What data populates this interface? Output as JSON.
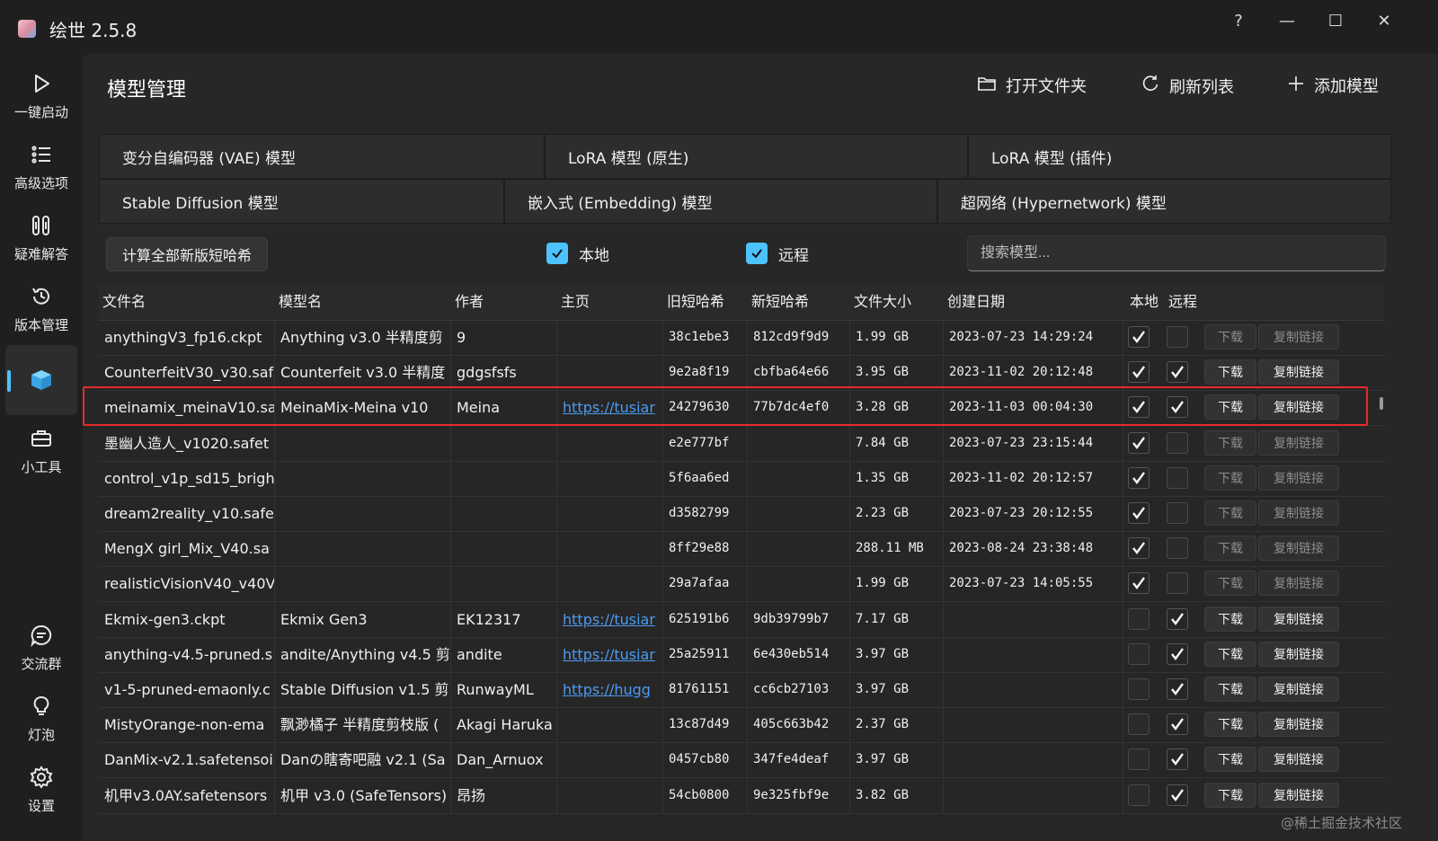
{
  "app": {
    "title": "绘世 2.5.8"
  },
  "window_controls": {
    "help": "?",
    "minimize": "—",
    "maximize": "☐",
    "close": "✕"
  },
  "nav": {
    "items": [
      {
        "label": "一键启动",
        "icon": "play-icon"
      },
      {
        "label": "高级选项",
        "icon": "list-icon"
      },
      {
        "label": "疑难解答",
        "icon": "tools-icon"
      },
      {
        "label": "版本管理",
        "icon": "history-icon"
      },
      {
        "label": "",
        "icon": "cube-icon"
      },
      {
        "label": "小工具",
        "icon": "toolbox-icon"
      },
      {
        "label": "交流群",
        "icon": "chat-icon"
      },
      {
        "label": "灯泡",
        "icon": "bulb-icon"
      },
      {
        "label": "设置",
        "icon": "gear-icon"
      }
    ]
  },
  "page": {
    "title": "模型管理"
  },
  "actions": {
    "open_folder": "打开文件夹",
    "refresh": "刷新列表",
    "add_model": "添加模型"
  },
  "tabs": {
    "row1": [
      "变分自编码器 (VAE) 模型",
      "LoRA 模型 (原生)",
      "LoRA 模型 (插件)"
    ],
    "row2": [
      "Stable Diffusion 模型",
      "嵌入式 (Embedding) 模型",
      "超网络 (Hypernetwork) 模型"
    ]
  },
  "toolbar": {
    "calc_button": "计算全部新版短哈希",
    "local_label": "本地",
    "local_checked": true,
    "remote_label": "远程",
    "remote_checked": true,
    "search_placeholder": "搜索模型..."
  },
  "table": {
    "columns": [
      "文件名",
      "模型名",
      "作者",
      "主页",
      "旧短哈希",
      "新短哈希",
      "文件大小",
      "创建日期",
      "本地",
      "远程"
    ],
    "download_label": "下载",
    "copy_label": "复制链接",
    "rows": [
      {
        "file": "anythingV3_fp16.ckpt",
        "model": "Anything v3.0 半精度剪",
        "author": "9",
        "home": "",
        "old": "38c1ebe3",
        "new": "812cd9f9d9",
        "size": "1.99 GB",
        "date": "2023-07-23 14:29:24",
        "local": true,
        "remote": false
      },
      {
        "file": "CounterfeitV30_v30.saf",
        "model": "Counterfeit v3.0 半精度",
        "author": "gdgsfsfs",
        "home": "",
        "old": "9e2a8f19",
        "new": "cbfba64e66",
        "size": "3.95 GB",
        "date": "2023-11-02 20:12:48",
        "local": true,
        "remote": true
      },
      {
        "file": "meinamix_meinaV10.sa",
        "model": "MeinaMix-Meina v10",
        "author": "Meina",
        "home": "https://tusiar",
        "old": "24279630",
        "new": "77b7dc4ef0",
        "size": "3.28 GB",
        "date": "2023-11-03 00:04:30",
        "local": true,
        "remote": true
      },
      {
        "file": "墨幽人造人_v1020.safet",
        "model": "",
        "author": "",
        "home": "",
        "old": "e2e777bf",
        "new": "",
        "size": "7.84 GB",
        "date": "2023-07-23 23:15:44",
        "local": true,
        "remote": false
      },
      {
        "file": "control_v1p_sd15_brigh",
        "model": "",
        "author": "",
        "home": "",
        "old": "5f6aa6ed",
        "new": "",
        "size": "1.35 GB",
        "date": "2023-11-02 20:12:57",
        "local": true,
        "remote": false
      },
      {
        "file": "dream2reality_v10.safe",
        "model": "",
        "author": "",
        "home": "",
        "old": "d3582799",
        "new": "",
        "size": "2.23 GB",
        "date": "2023-07-23 20:12:55",
        "local": true,
        "remote": false
      },
      {
        "file": "MengX girl_Mix_V40.sa",
        "model": "",
        "author": "",
        "home": "",
        "old": "8ff29e88",
        "new": "",
        "size": "288.11 MB",
        "date": "2023-08-24 23:38:48",
        "local": true,
        "remote": false
      },
      {
        "file": "realisticVisionV40_v40V",
        "model": "",
        "author": "",
        "home": "",
        "old": "29a7afaa",
        "new": "",
        "size": "1.99 GB",
        "date": "2023-07-23 14:05:55",
        "local": true,
        "remote": false
      },
      {
        "file": "Ekmix-gen3.ckpt",
        "model": "Ekmix Gen3",
        "author": "EK12317",
        "home": "https://tusiar",
        "old": "625191b6",
        "new": "9db39799b7",
        "size": "7.17 GB",
        "date": "",
        "local": false,
        "remote": true
      },
      {
        "file": "anything-v4.5-pruned.s",
        "model": "andite/Anything v4.5 剪",
        "author": "andite",
        "home": "https://tusiar",
        "old": "25a25911",
        "new": "6e430eb514",
        "size": "3.97 GB",
        "date": "",
        "local": false,
        "remote": true
      },
      {
        "file": "v1-5-pruned-emaonly.c",
        "model": "Stable Diffusion v1.5 剪",
        "author": "RunwayML",
        "home": "https://hugg",
        "old": "81761151",
        "new": "cc6cb27103",
        "size": "3.97 GB",
        "date": "",
        "local": false,
        "remote": true
      },
      {
        "file": "MistyOrange-non-ema",
        "model": "飘渺橘子 半精度剪枝版 (",
        "author": "Akagi Haruka",
        "home": "",
        "old": "13c87d49",
        "new": "405c663b42",
        "size": "2.37 GB",
        "date": "",
        "local": false,
        "remote": true
      },
      {
        "file": "DanMix-v2.1.safetensoi",
        "model": "Danの瞎寄吧融 v2.1 (Sa",
        "author": "Dan_Arnuox",
        "home": "",
        "old": "0457cb80",
        "new": "347fe4deaf",
        "size": "3.97 GB",
        "date": "",
        "local": false,
        "remote": true
      },
      {
        "file": "机甲v3.0AY.safetensors",
        "model": "机甲 v3.0 (SafeTensors)",
        "author": "昂扬",
        "home": "",
        "old": "54cb0800",
        "new": "9e325fbf9e",
        "size": "3.82 GB",
        "date": "",
        "local": false,
        "remote": true
      }
    ]
  },
  "watermark": "@稀土掘金技术社区",
  "colors": {
    "accent": "#4cc2ff",
    "highlight": "#e52b2b",
    "link": "#4c9bf0"
  }
}
